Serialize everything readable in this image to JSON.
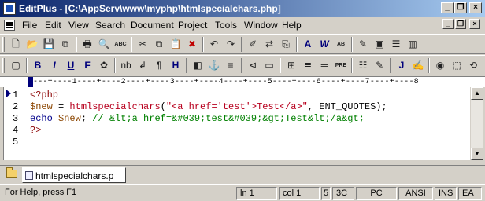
{
  "window": {
    "title": "EditPlus - [C:\\AppServ\\www\\myphp\\htmlspecialchars.php]",
    "minimize_glyph": "_",
    "restore_glyph": "❐",
    "close_glyph": "×"
  },
  "menu": {
    "items": [
      "File",
      "Edit",
      "View",
      "Search",
      "Document",
      "Project",
      "Tools",
      "Window",
      "Help"
    ]
  },
  "toolbar_standard": {
    "icons": [
      "new-file-icon",
      "open-folder-icon",
      "save-icon",
      "save-all-icon",
      "print-icon",
      "print-preview-icon",
      "spellcheck-icon",
      "cut-icon",
      "copy-icon",
      "paste-icon",
      "delete-icon",
      "undo-icon",
      "redo-icon",
      "find-icon",
      "replace-icon",
      "find-in-files-icon",
      "font-icon",
      "word-wrap-icon",
      "hex-view-icon",
      "tool-icon",
      "window-icon",
      "window-list-icon",
      "directory-icon"
    ],
    "glyphs": [
      "🗋",
      "📂",
      "💾",
      "⧉",
      "🖶",
      "🔍",
      "ABC",
      "✂",
      "⧉",
      "📋",
      "✖",
      "↶",
      "↷",
      "✐",
      "⇄",
      "⎘",
      "A",
      "W",
      "AB",
      "✎",
      "▣",
      "☰",
      "▥"
    ]
  },
  "toolbar_html": {
    "icons": [
      "html-toolbar-icon",
      "bold-icon",
      "italic-icon",
      "underline-icon",
      "font-tag-icon",
      "color-icon",
      "nbsp-icon",
      "br-icon",
      "paragraph-icon",
      "heading-icon",
      "image-icon",
      "anchor-icon",
      "align-left-icon",
      "comment-icon",
      "form-icon",
      "table-icon",
      "center-icon",
      "hr-icon",
      "pre-icon",
      "list-icon",
      "script-icon",
      "java-icon",
      "css-icon",
      "view-browser-icon",
      "view-tool-icon",
      "view-source-icon",
      "refresh-icon"
    ],
    "glyphs": [
      "▢",
      "B",
      "I",
      "U",
      "F",
      "✿",
      "nb",
      "↲",
      "¶",
      "H",
      "◧",
      "⚓",
      "≡",
      "⊲",
      "▭",
      "⊞",
      "≣",
      "═",
      "PRE",
      "☷",
      "✎",
      "J",
      "✍",
      "◉",
      "⬚",
      "⟲",
      "↻"
    ]
  },
  "ruler": {
    "text": "---+----1----+----2----+----3----+----4----+----5----+----6----+----7----+----8"
  },
  "editor": {
    "lines": [
      {
        "number": "1",
        "tokens": [
          {
            "type": "php",
            "text": "<?php"
          }
        ]
      },
      {
        "number": "2",
        "tokens": [
          {
            "type": "var",
            "text": "$new"
          },
          {
            "type": "plain",
            "text": " = "
          },
          {
            "type": "func",
            "text": "htmlspecialchars"
          },
          {
            "type": "plain",
            "text": "("
          },
          {
            "type": "str",
            "text": "\"<a href='test'>Test</a>\""
          },
          {
            "type": "plain",
            "text": ", ENT_QUOTES);"
          }
        ]
      },
      {
        "number": "3",
        "tokens": [
          {
            "type": "kw",
            "text": "echo"
          },
          {
            "type": "plain",
            "text": " "
          },
          {
            "type": "var",
            "text": "$new"
          },
          {
            "type": "plain",
            "text": "; "
          },
          {
            "type": "cmt",
            "text": "// &lt;a href=&#039;test&#039;&gt;Test&lt;/a&gt;"
          }
        ]
      },
      {
        "number": "4",
        "tokens": [
          {
            "type": "php",
            "text": "?>"
          }
        ]
      },
      {
        "number": "5",
        "tokens": []
      }
    ]
  },
  "tabs": {
    "active_label": "htmlspecialchars.p"
  },
  "status": {
    "help": "For Help, press F1",
    "line": "ln 1",
    "col": "col 1",
    "num": "5",
    "hex": "3C",
    "format": "PC",
    "encoding": "ANSI",
    "ins": "INS",
    "extra": "EA"
  },
  "colors": {
    "titlebar_start": "#0a246a",
    "titlebar_end": "#a6caf0",
    "php_tag": "#8b0000",
    "variable": "#8b4500",
    "function": "#b8001e",
    "string": "#b8001e",
    "keyword": "#00008b",
    "comment": "#008000"
  }
}
